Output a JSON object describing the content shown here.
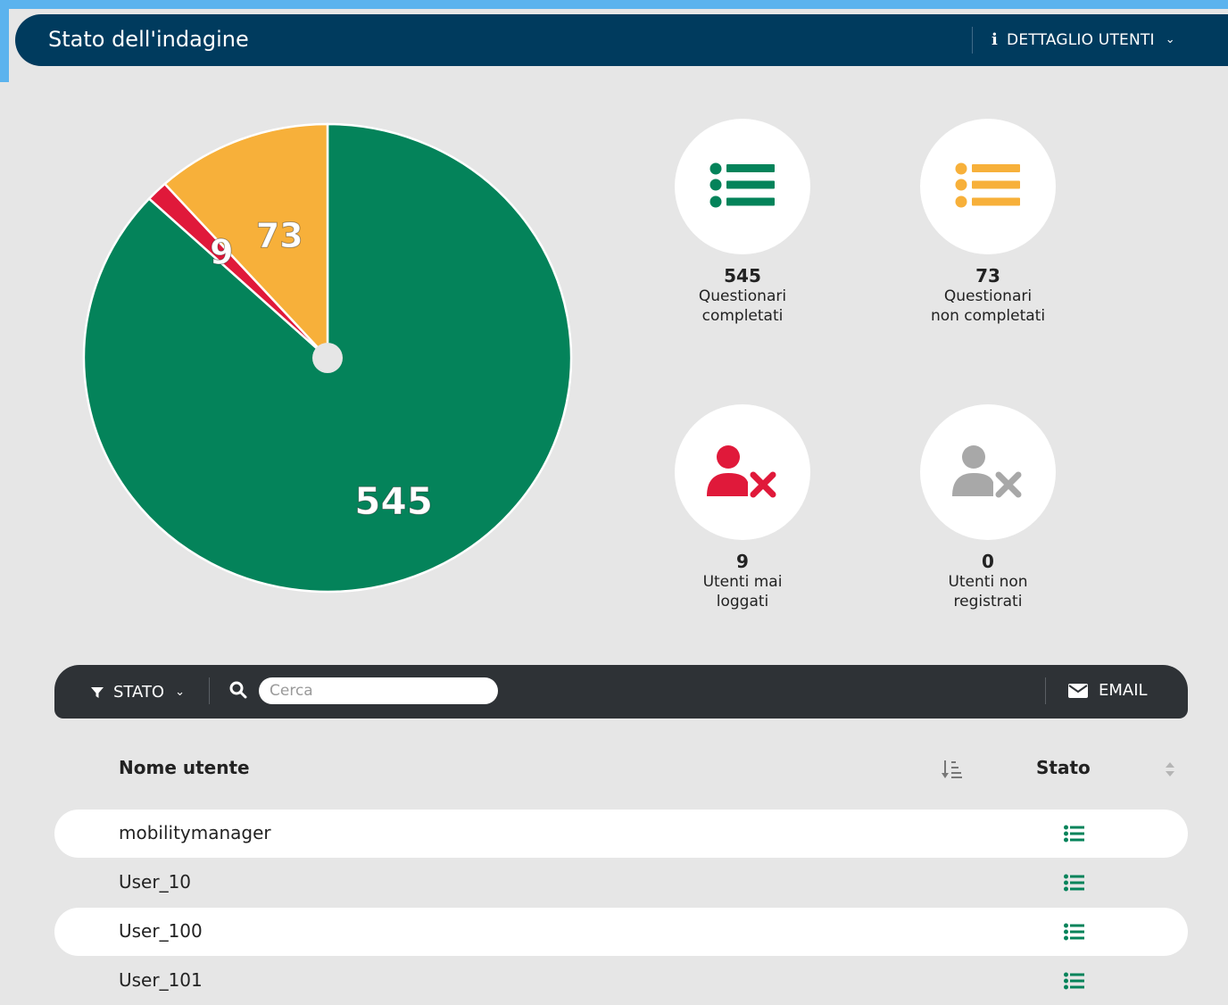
{
  "header": {
    "title": "Stato dell'indagine",
    "detail_label": "DETTAGLIO UTENTI"
  },
  "colors": {
    "completed": "#04835a",
    "not_completed": "#f7b03a",
    "never_logged": "#e0193a",
    "not_registered": "#a8a8a8",
    "header_bg": "#003b5e",
    "toolbar_bg": "#2e3236"
  },
  "chart_data": {
    "type": "pie",
    "slices": [
      {
        "label": "545",
        "value": 545,
        "color": "#04835a"
      },
      {
        "label": "9",
        "value": 9,
        "color": "#e0193a"
      },
      {
        "label": "73",
        "value": 73,
        "color": "#f7b03a"
      }
    ]
  },
  "stats": [
    {
      "value": "545",
      "line1": "Questionari",
      "line2": "completati",
      "icon": "list-icon",
      "color": "#04835a"
    },
    {
      "value": "73",
      "line1": "Questionari",
      "line2": "non completati",
      "icon": "list-icon",
      "color": "#f7b03a"
    },
    {
      "value": "9",
      "line1": "Utenti mai",
      "line2": "loggati",
      "icon": "user-x-icon",
      "color": "#e0193a"
    },
    {
      "value": "0",
      "line1": "Utenti non",
      "line2": "registrati",
      "icon": "user-x-icon",
      "color": "#a8a8a8"
    }
  ],
  "toolbar": {
    "filter_label": "STATO",
    "search_placeholder": "Cerca",
    "email_label": "EMAIL"
  },
  "table": {
    "columns": [
      "Nome utente",
      "Stato"
    ],
    "rows": [
      {
        "name": "mobilitymanager",
        "status_icon": "list-icon"
      },
      {
        "name": "User_10",
        "status_icon": "list-icon"
      },
      {
        "name": "User_100",
        "status_icon": "list-icon"
      },
      {
        "name": "User_101",
        "status_icon": "list-icon"
      }
    ]
  }
}
